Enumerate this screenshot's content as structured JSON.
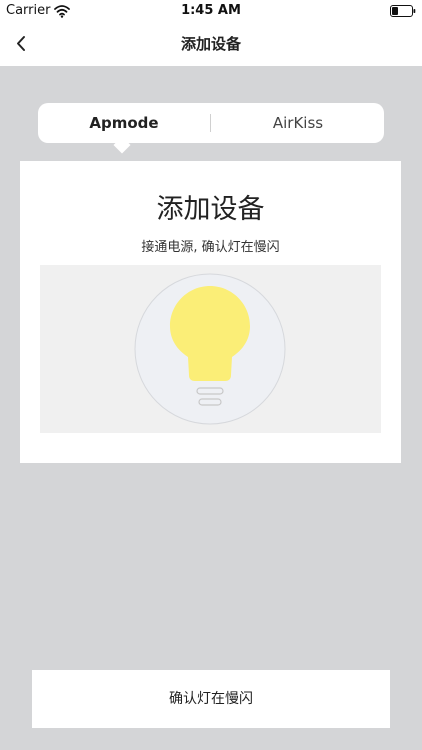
{
  "status_bar": {
    "carrier": "Carrier",
    "time": "1:45 AM"
  },
  "nav": {
    "title": "添加设备",
    "back_icon": "chevron-left-icon"
  },
  "mode_tabs": {
    "items": [
      {
        "label": "Apmode",
        "selected": true
      },
      {
        "label": "AirKiss",
        "selected": false
      }
    ]
  },
  "card": {
    "title": "添加设备",
    "subtitle": "接通电源, 确认灯在慢闪",
    "illustration_icon": "light-bulb-icon"
  },
  "confirm_button": {
    "label": "确认灯在慢闪"
  },
  "colors": {
    "background": "#d4d5d7",
    "bulb": "#fbee77"
  }
}
